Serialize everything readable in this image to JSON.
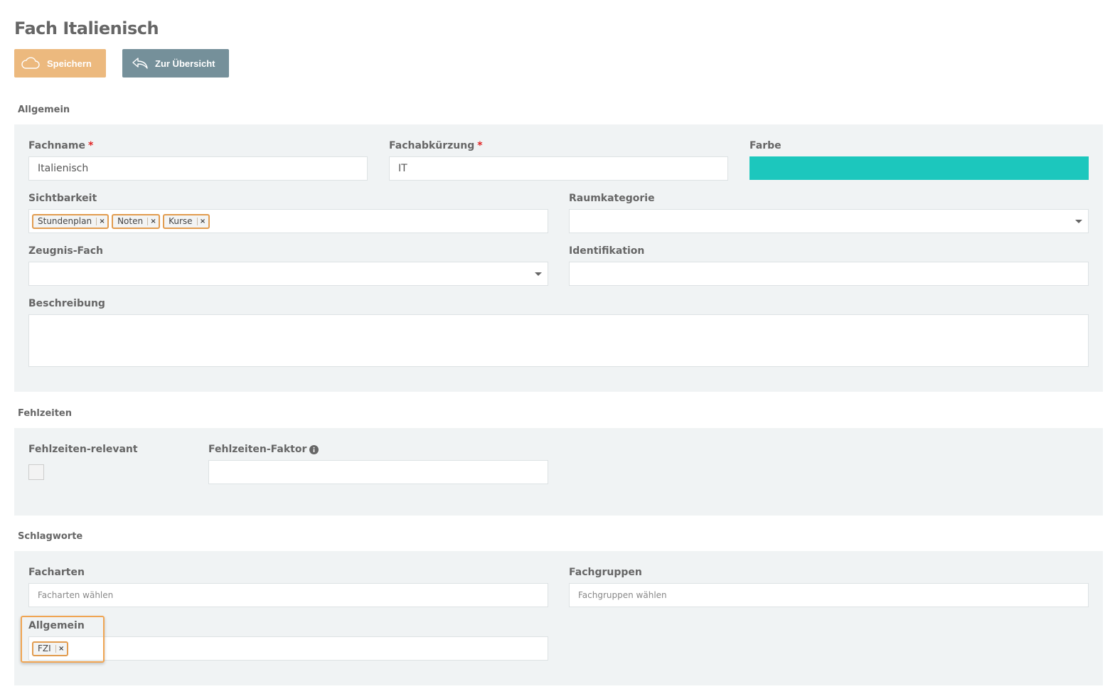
{
  "page": {
    "title": "Fach Italienisch"
  },
  "toolbar": {
    "save_label": "Speichern",
    "back_label": "Zur Übersicht"
  },
  "sections": {
    "general": {
      "title": "Allgemein",
      "fachname": {
        "label": "Fachname",
        "required": "*",
        "value": "Italienisch"
      },
      "kuerzel": {
        "label": "Fachabkürzung",
        "required": "*",
        "value": "IT"
      },
      "farbe": {
        "label": "Farbe",
        "color": "#1cc7bd"
      },
      "sichtbarkeit": {
        "label": "Sichtbarkeit",
        "tags": [
          "Stundenplan",
          "Noten",
          "Kurse"
        ]
      },
      "raumkategorie": {
        "label": "Raumkategorie",
        "value": ""
      },
      "zeugnisfach": {
        "label": "Zeugnis-Fach",
        "value": ""
      },
      "identifikation": {
        "label": "Identifikation",
        "value": ""
      },
      "beschreibung": {
        "label": "Beschreibung",
        "value": ""
      }
    },
    "absence": {
      "title": "Fehlzeiten",
      "relevant": {
        "label": "Fehlzeiten-relevant",
        "checked": false
      },
      "faktor": {
        "label": "Fehlzeiten-Faktor",
        "value": ""
      }
    },
    "keywords": {
      "title": "Schlagworte",
      "facharten": {
        "label": "Facharten",
        "placeholder": "Facharten wählen"
      },
      "fachgruppen": {
        "label": "Fachgruppen",
        "placeholder": "Fachgruppen wählen"
      },
      "allgemein": {
        "label": "Allgemein",
        "tags": [
          "FZI"
        ]
      }
    }
  },
  "tag_remove": "×",
  "colors": {
    "save": "#ecb97e",
    "back": "#75909a",
    "panel": "#f0f3f4",
    "tag_border": "#e29c4f",
    "highlight": "#f0a553"
  }
}
